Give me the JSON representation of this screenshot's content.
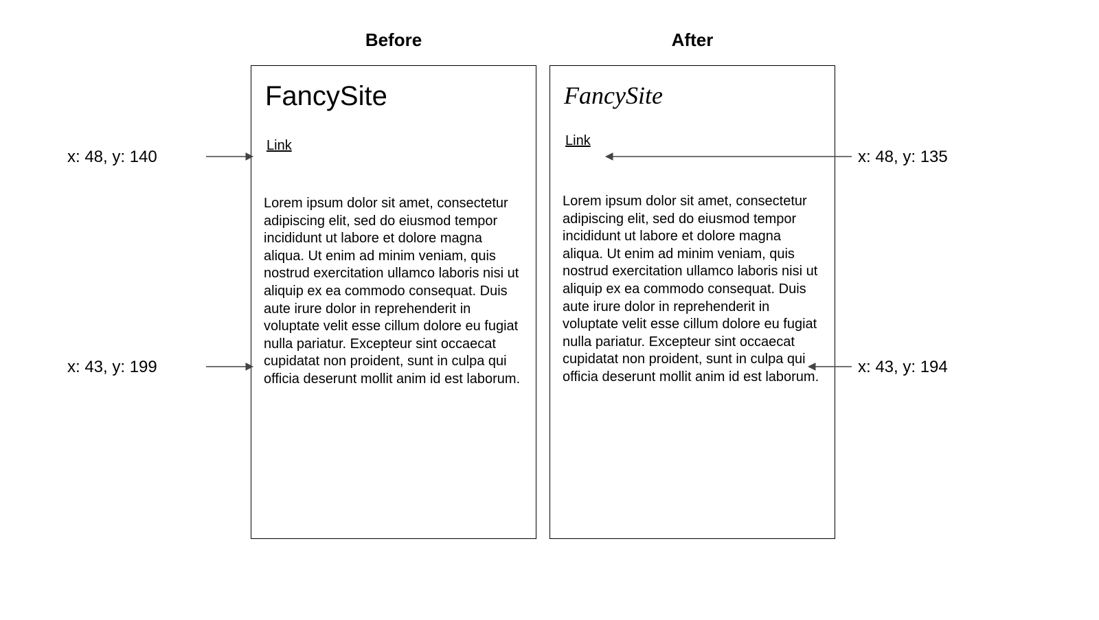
{
  "headers": {
    "before": "Before",
    "after": "After"
  },
  "panel": {
    "title": "FancySite",
    "link_text": "Link",
    "body": "Lorem ipsum dolor sit amet, consectetur adipiscing elit, sed do eiusmod tempor incididunt ut labore et dolore magna aliqua. Ut enim ad minim veniam, quis nostrud exercitation ullamco laboris nisi ut aliquip ex ea commodo consequat. Duis aute irure dolor in reprehenderit in voluptate velit esse cillum dolore eu fugiat nulla pariatur. Excepteur sint occaecat cupidatat non proident, sunt in culpa qui officia deserunt mollit anim id est laborum."
  },
  "coords": {
    "before_link": "x: 48, y: 140",
    "before_body": "x: 43, y: 199",
    "after_link": "x: 48, y: 135",
    "after_body": "x: 43, y: 194"
  }
}
